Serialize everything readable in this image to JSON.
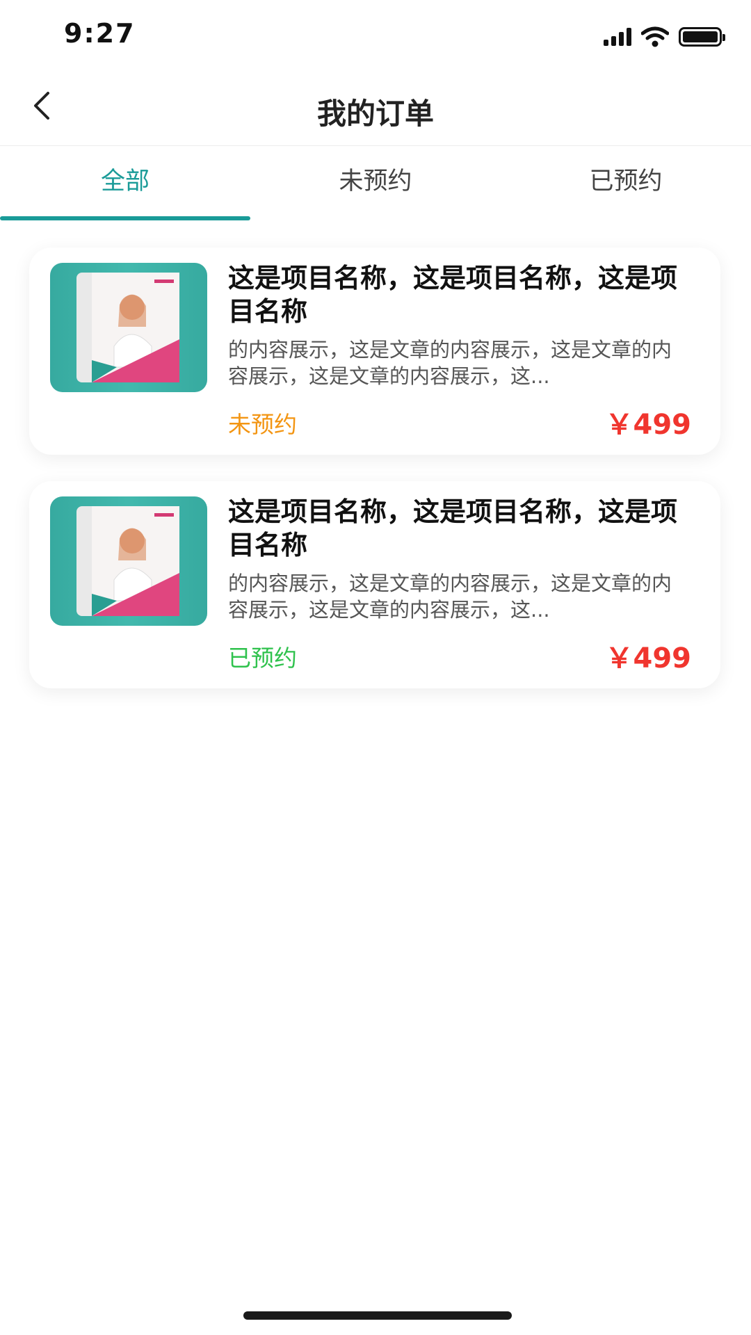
{
  "status_bar": {
    "time": "9:27",
    "icons": [
      "signal-icon",
      "wifi-icon",
      "battery-icon"
    ]
  },
  "nav": {
    "back_icon": "chevron-left-icon",
    "title": "我的订单"
  },
  "tabs": [
    {
      "label": "全部",
      "active": true
    },
    {
      "label": "未预约",
      "active": false
    },
    {
      "label": "已预约",
      "active": false
    }
  ],
  "colors": {
    "accent": "#1a9b98",
    "status_pending": "#f39512",
    "status_done": "#2fc24d",
    "price": "#f0352e"
  },
  "orders": [
    {
      "thumbnail_icon": "magazine-cover-image",
      "title": "这是项目名称，这是项目名称，这是项目名称",
      "description": "的内容展示，这是文章的内容展示，这是文章的内容展示，这是文章的内容展示，这...",
      "status": "未预约",
      "price": "￥499"
    },
    {
      "thumbnail_icon": "magazine-cover-image",
      "title": "这是项目名称，这是项目名称，这是项目名称",
      "description": "的内容展示，这是文章的内容展示，这是文章的内容展示，这是文章的内容展示，这...",
      "status": "已预约",
      "price": "￥499"
    }
  ]
}
